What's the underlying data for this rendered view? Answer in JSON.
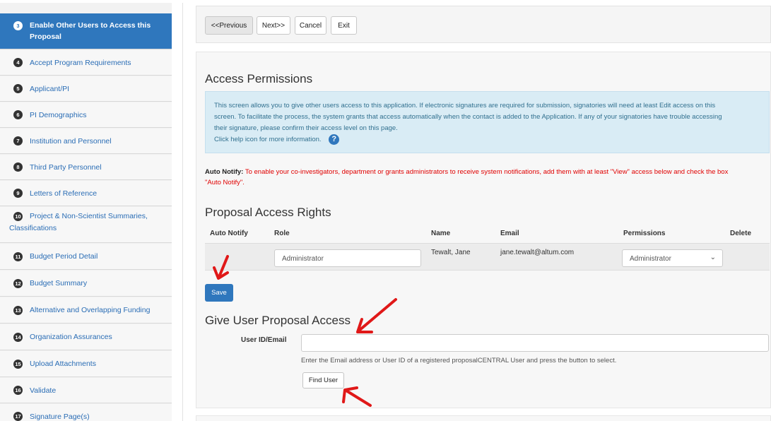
{
  "sidebar": {
    "items": [
      {
        "num": "3",
        "label": "Enable Other Users to Access this Proposal",
        "active": true
      },
      {
        "num": "4",
        "label": "Accept Program Requirements"
      },
      {
        "num": "5",
        "label": "Applicant/PI"
      },
      {
        "num": "6",
        "label": "PI Demographics"
      },
      {
        "num": "7",
        "label": "Institution and Personnel"
      },
      {
        "num": "8",
        "label": "Third Party Personnel"
      },
      {
        "num": "9",
        "label": "Letters of Reference"
      },
      {
        "num": "10",
        "label": "Project & Non-Scientist Summaries, Classifications"
      },
      {
        "num": "11",
        "label": "Budget Period Detail"
      },
      {
        "num": "12",
        "label": "Budget Summary"
      },
      {
        "num": "13",
        "label": "Alternative and Overlapping Funding"
      },
      {
        "num": "14",
        "label": "Organization Assurances"
      },
      {
        "num": "15",
        "label": "Upload Attachments"
      },
      {
        "num": "16",
        "label": "Validate"
      },
      {
        "num": "17",
        "label": "Signature Page(s)"
      }
    ]
  },
  "toolbar": {
    "previous": "<<Previous",
    "next": "Next>>",
    "cancel": "Cancel",
    "exit": "Exit"
  },
  "access": {
    "title": "Access Permissions",
    "info_lines": [
      "This screen allows you to give other users access to this application. If electronic signatures are required for submission, signatories will need at least Edit access on this",
      "screen. To facilitate the process, the system grants that access automatically when the contact is added to the Application. If any of your signatories have trouble accessing",
      "their signature, please confirm their access level on this page."
    ],
    "help_line": "Click help icon for more information.",
    "help_icon": "?",
    "auto_notify_label": "Auto Notify:",
    "auto_notify_text": "To enable your co-investigators, department or grants administrators to receive system notifications, add them with at least \"View\" access below and check the box",
    "auto_notify_text2": "\"Auto Notify\"."
  },
  "rights": {
    "title": "Proposal Access Rights",
    "columns": {
      "auto_notify": "Auto Notify",
      "role": "Role",
      "name": "Name",
      "email": "Email",
      "permissions": "Permissions",
      "delete": "Delete"
    },
    "row": {
      "role": "Administrator",
      "name": "Tewalt, Jane",
      "email": "jane.tewalt@altum.com",
      "permission": "Administrator"
    },
    "save": "Save"
  },
  "give_access": {
    "title": "Give User Proposal Access",
    "label": "User ID/Email",
    "input_value": "",
    "help": "Enter the Email address or User ID of a registered proposalCENTRAL User and press the button to select.",
    "find_button": "Find User"
  },
  "colors": {
    "accent": "#2f77bd",
    "arrow": "#e01818",
    "info_bg": "#d9ecf5",
    "warning_text": "#e00000"
  }
}
